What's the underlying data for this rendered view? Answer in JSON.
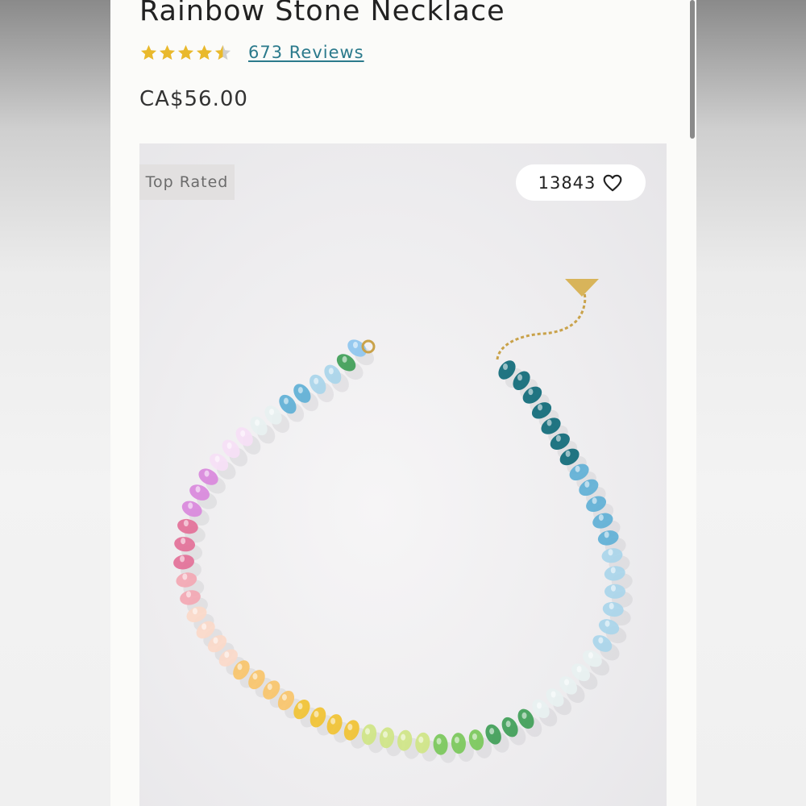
{
  "product": {
    "title": "Rainbow Stone Necklace",
    "rating": 4.5,
    "rating_max": 5,
    "reviews_label": "673 Reviews",
    "price": "CA$56.00"
  },
  "image": {
    "badge": "Top Rated",
    "favorites_count": "13843"
  },
  "colors": {
    "star_fill": "#e9b92c",
    "star_empty": "#cfcfcf",
    "link": "#2b7a8c",
    "bead_palette": [
      "#0f6a78",
      "#5fb0d6",
      "#a9d5ea",
      "#e8f1f1",
      "#f6e0f6",
      "#d988dc",
      "#e37098",
      "#f3a7b3",
      "#fbd9c9",
      "#f8c46a",
      "#f1c232",
      "#cfe585",
      "#7ac85a",
      "#3f9e57",
      "#8ec6ef"
    ]
  },
  "icons": {
    "star": "star-icon",
    "heart": "heart-outline-icon"
  }
}
